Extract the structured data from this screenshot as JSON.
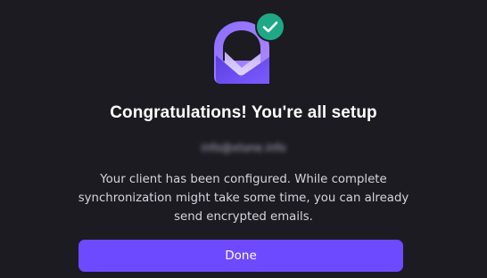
{
  "dialog": {
    "icons": {
      "logo": "proton-mail-envelope-icon",
      "badge": "check-icon"
    },
    "title": "Congratulations! You're all setup",
    "email": "info@xtone.info",
    "message_lines": [
      "Your client has been configured. While complete",
      "synchronization might take some time, you can already",
      "send encrypted emails."
    ],
    "done_label": "Done"
  },
  "colors": {
    "background": "#1c1b22",
    "accent": "#6d4aff",
    "success": "#1ea885",
    "text_primary": "#ffffff",
    "text_secondary": "#d6d4de"
  }
}
